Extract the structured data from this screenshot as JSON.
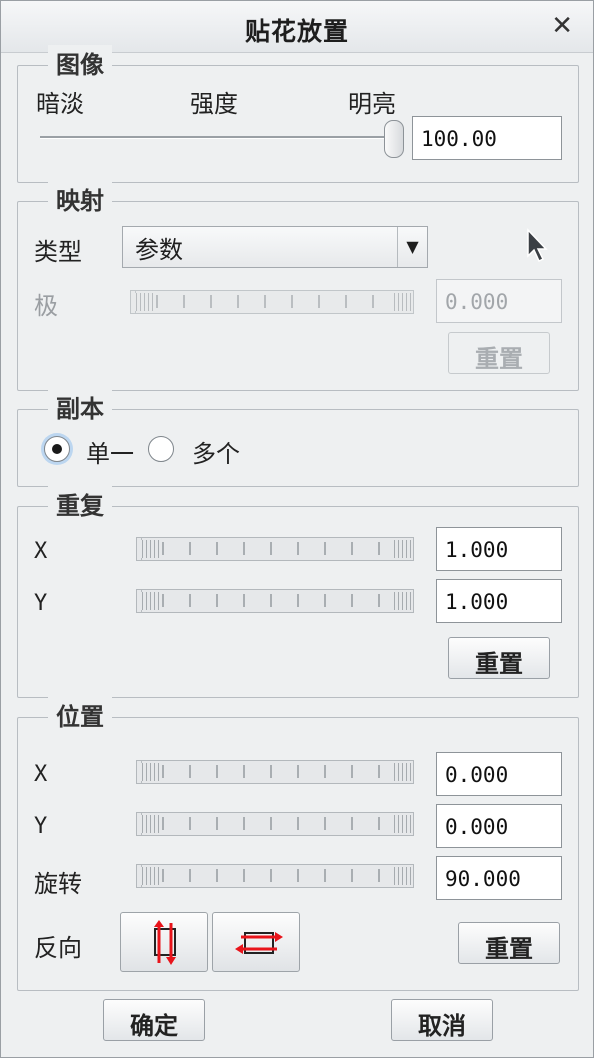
{
  "title": "贴花放置",
  "close_glyph": "✕",
  "image": {
    "legend": "图像",
    "label_dark": "暗淡",
    "label_strength": "强度",
    "label_bright": "明亮",
    "slider_value_fraction": 1.0,
    "value": "100.00"
  },
  "mapping": {
    "legend": "映射",
    "type_label": "类型",
    "type_value": "参数",
    "dropdown_glyph": "▼",
    "pole_label": "极",
    "pole_value": "0.000",
    "reset_label": "重置"
  },
  "copy": {
    "legend": "副本",
    "options": [
      {
        "label": "单一",
        "checked": true
      },
      {
        "label": "多个",
        "checked": false
      }
    ]
  },
  "repeat": {
    "legend": "重复",
    "x_label": "X",
    "x_value": "1.000",
    "y_label": "Y",
    "y_value": "1.000",
    "reset_label": "重置"
  },
  "position": {
    "legend": "位置",
    "x_label": "X",
    "x_value": "0.000",
    "y_label": "Y",
    "y_value": "0.000",
    "rotate_label": "旋转",
    "rotate_value": "90.000",
    "flip_label": "反向",
    "reset_label": "重置"
  },
  "footer": {
    "ok_label": "确定",
    "cancel_label": "取消"
  },
  "colors": {
    "flip_arrow": "#e8141b"
  }
}
